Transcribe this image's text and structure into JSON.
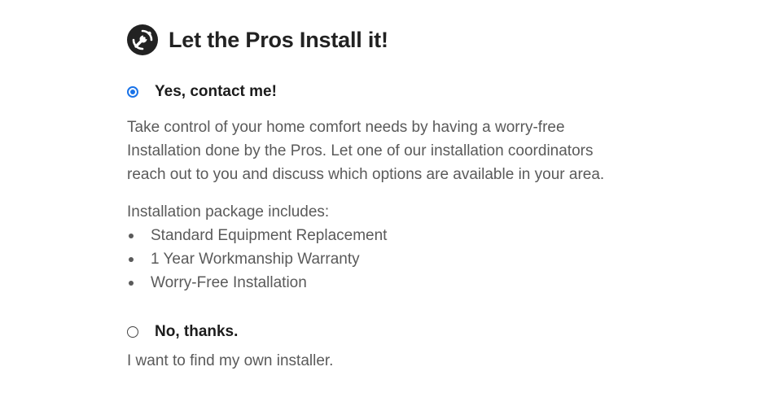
{
  "header": {
    "icon": "wrench-gear-icon",
    "title": "Let the Pros Install it!"
  },
  "options": {
    "yes": {
      "label": "Yes, contact me!",
      "selected": true
    },
    "no": {
      "label": "No, thanks.",
      "selected": false
    }
  },
  "description": {
    "lines": [
      "Take control of your home comfort needs by having a worry-free",
      "Installation done by the Pros. Let one of our installation coordinators",
      "reach out to you and discuss which options are available in your area."
    ]
  },
  "package": {
    "heading": "Installation package includes:",
    "items": [
      "Standard Equipment Replacement",
      "1 Year Workmanship Warranty",
      "Worry-Free Installation"
    ]
  },
  "no_description": "I want to find my own installer.",
  "colors": {
    "accent": "#1a73e8",
    "heading": "#222222",
    "text": "#5a5a5a"
  }
}
